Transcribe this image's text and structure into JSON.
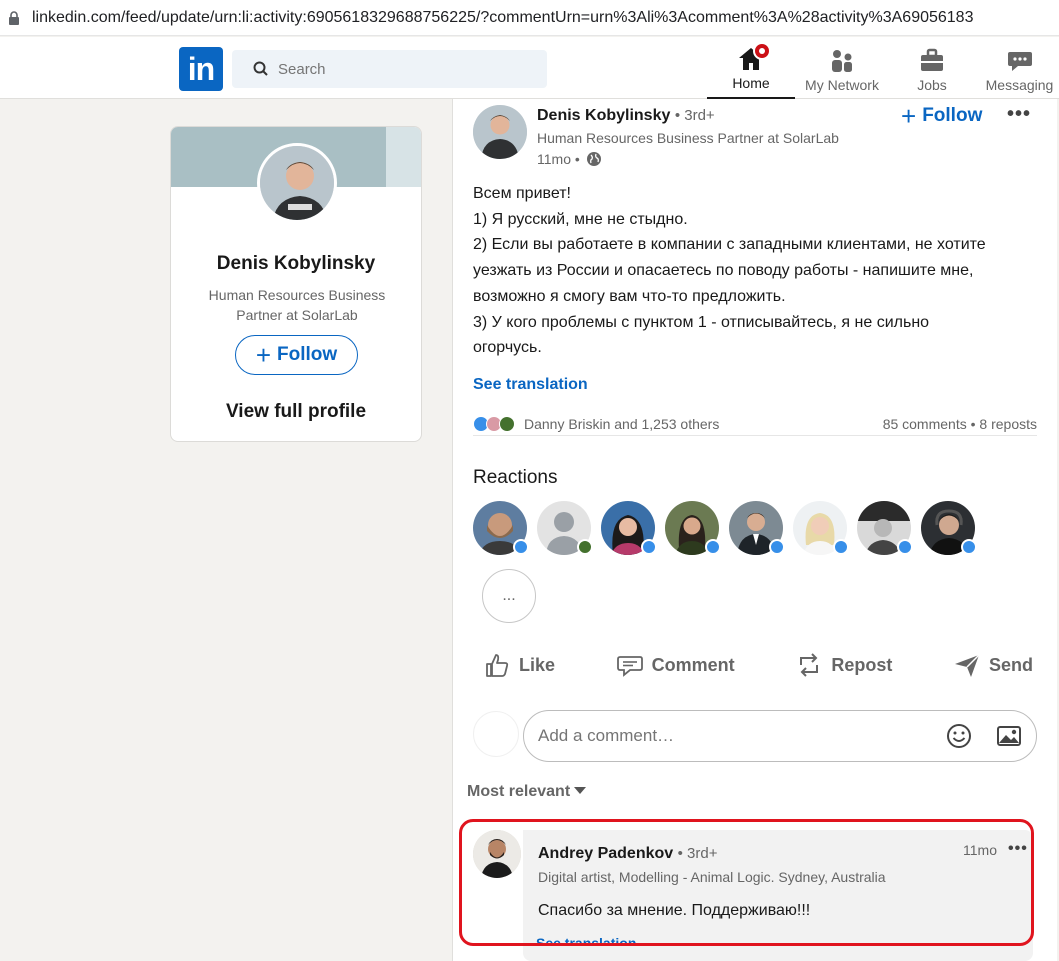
{
  "browser": {
    "url": "linkedin.com/feed/update/urn:li:activity:6905618329688756225/?commentUrn=urn%3Ali%3Acomment%3A%28activity%3A69056183"
  },
  "nav": {
    "logo": "in",
    "search_placeholder": "Search",
    "items": [
      {
        "label": "Home",
        "icon": "home-icon"
      },
      {
        "label": "My Network",
        "icon": "network-icon"
      },
      {
        "label": "Jobs",
        "icon": "briefcase-icon"
      },
      {
        "label": "Messaging",
        "icon": "messaging-icon"
      }
    ],
    "active": "Home"
  },
  "profile_card": {
    "name": "Denis Kobylinsky",
    "title": "Human Resources Business Partner at SolarLab",
    "follow_label": "Follow",
    "view_profile_label": "View full profile"
  },
  "post": {
    "author": "Denis Kobylinsky",
    "degree": "• 3rd+",
    "headline": "Human Resources Business Partner at SolarLab",
    "time": "11mo •",
    "follow_label": "Follow",
    "more": "•••",
    "lines": [
      "Всем привет!",
      "1) Я русский, мне не стыдно.",
      "2) Если вы работаете в компании с западными клиентами, не хотите",
      "уезжать из России и опасаетесь по поводу работы - напишите мне,",
      "возможно я смогу вам что-то предложить.",
      "3) У кого проблемы с пунктом 1 - отписывайтесь, я не сильно",
      "огорчусь."
    ],
    "see_translation": "See translation",
    "reactions_summary": "Danny Briskin and 1,253 others",
    "comments_reposts": "85 comments • 8 reposts",
    "reactions_title": "Reactions",
    "more_reactors": "...",
    "actions": {
      "like": "Like",
      "comment": "Comment",
      "repost": "Repost",
      "send": "Send"
    },
    "comment_placeholder": "Add a comment…",
    "sort_label": "Most relevant"
  },
  "comment": {
    "author": "Andrey Padenkov",
    "degree": "• 3rd+",
    "headline": "Digital artist, Modelling - Animal Logic. Sydney, Australia",
    "time": "11mo",
    "more": "•••",
    "text": "Спасибо за мнение. Поддерживаю!!!",
    "see_translation": "See translation"
  },
  "colors": {
    "brand": "#0a66c2",
    "highlight": "#e0141e",
    "background": "#f3f2ef"
  }
}
